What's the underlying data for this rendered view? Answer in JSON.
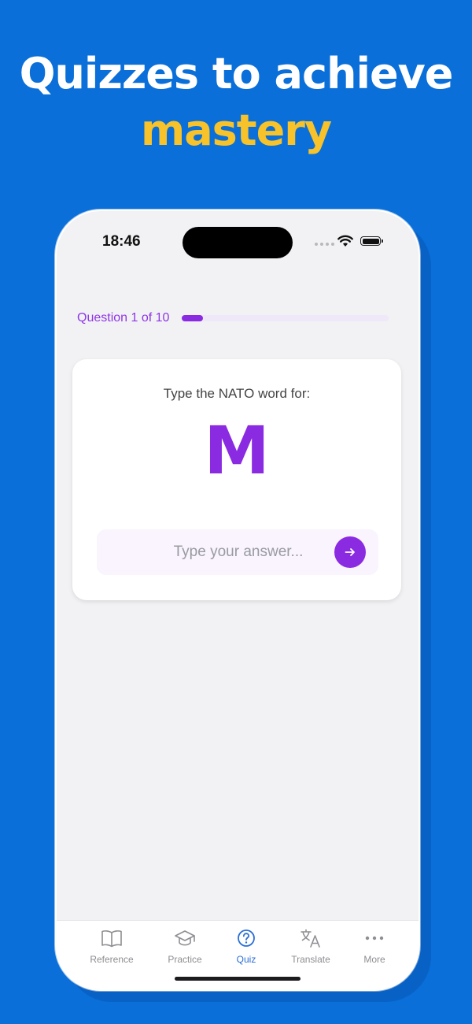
{
  "promo": {
    "line1": "Quizzes to achieve",
    "line2": "mastery"
  },
  "status_bar": {
    "time": "18:46"
  },
  "quiz": {
    "progress_label": "Question 1 of 10",
    "progress_fraction": 0.1,
    "prompt": "Type the NATO word for:",
    "letter": "M",
    "answer_placeholder": "Type your answer..."
  },
  "tabs": [
    {
      "label": "Reference",
      "icon": "book-icon",
      "active": false
    },
    {
      "label": "Practice",
      "icon": "graduation-cap-icon",
      "active": false
    },
    {
      "label": "Quiz",
      "icon": "question-circle-icon",
      "active": true
    },
    {
      "label": "Translate",
      "icon": "translate-icon",
      "active": false
    },
    {
      "label": "More",
      "icon": "ellipsis-icon",
      "active": false
    }
  ],
  "colors": {
    "background": "#0a6fd9",
    "headline_accent": "#f7c22a",
    "quiz_accent": "#8a2be2",
    "tab_active": "#2a6fd6",
    "tab_inactive": "#8e8e93"
  }
}
